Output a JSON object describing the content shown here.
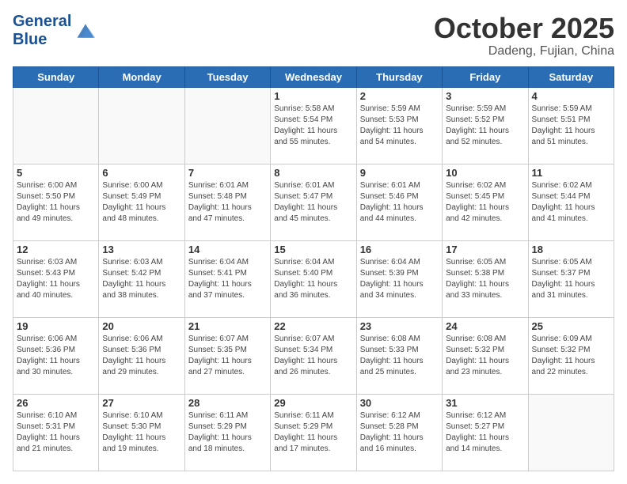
{
  "header": {
    "logo_line1": "General",
    "logo_line2": "Blue",
    "month": "October 2025",
    "location": "Dadeng, Fujian, China"
  },
  "weekdays": [
    "Sunday",
    "Monday",
    "Tuesday",
    "Wednesday",
    "Thursday",
    "Friday",
    "Saturday"
  ],
  "weeks": [
    [
      {
        "day": "",
        "info": ""
      },
      {
        "day": "",
        "info": ""
      },
      {
        "day": "",
        "info": ""
      },
      {
        "day": "1",
        "info": "Sunrise: 5:58 AM\nSunset: 5:54 PM\nDaylight: 11 hours\nand 55 minutes."
      },
      {
        "day": "2",
        "info": "Sunrise: 5:59 AM\nSunset: 5:53 PM\nDaylight: 11 hours\nand 54 minutes."
      },
      {
        "day": "3",
        "info": "Sunrise: 5:59 AM\nSunset: 5:52 PM\nDaylight: 11 hours\nand 52 minutes."
      },
      {
        "day": "4",
        "info": "Sunrise: 5:59 AM\nSunset: 5:51 PM\nDaylight: 11 hours\nand 51 minutes."
      }
    ],
    [
      {
        "day": "5",
        "info": "Sunrise: 6:00 AM\nSunset: 5:50 PM\nDaylight: 11 hours\nand 49 minutes."
      },
      {
        "day": "6",
        "info": "Sunrise: 6:00 AM\nSunset: 5:49 PM\nDaylight: 11 hours\nand 48 minutes."
      },
      {
        "day": "7",
        "info": "Sunrise: 6:01 AM\nSunset: 5:48 PM\nDaylight: 11 hours\nand 47 minutes."
      },
      {
        "day": "8",
        "info": "Sunrise: 6:01 AM\nSunset: 5:47 PM\nDaylight: 11 hours\nand 45 minutes."
      },
      {
        "day": "9",
        "info": "Sunrise: 6:01 AM\nSunset: 5:46 PM\nDaylight: 11 hours\nand 44 minutes."
      },
      {
        "day": "10",
        "info": "Sunrise: 6:02 AM\nSunset: 5:45 PM\nDaylight: 11 hours\nand 42 minutes."
      },
      {
        "day": "11",
        "info": "Sunrise: 6:02 AM\nSunset: 5:44 PM\nDaylight: 11 hours\nand 41 minutes."
      }
    ],
    [
      {
        "day": "12",
        "info": "Sunrise: 6:03 AM\nSunset: 5:43 PM\nDaylight: 11 hours\nand 40 minutes."
      },
      {
        "day": "13",
        "info": "Sunrise: 6:03 AM\nSunset: 5:42 PM\nDaylight: 11 hours\nand 38 minutes."
      },
      {
        "day": "14",
        "info": "Sunrise: 6:04 AM\nSunset: 5:41 PM\nDaylight: 11 hours\nand 37 minutes."
      },
      {
        "day": "15",
        "info": "Sunrise: 6:04 AM\nSunset: 5:40 PM\nDaylight: 11 hours\nand 36 minutes."
      },
      {
        "day": "16",
        "info": "Sunrise: 6:04 AM\nSunset: 5:39 PM\nDaylight: 11 hours\nand 34 minutes."
      },
      {
        "day": "17",
        "info": "Sunrise: 6:05 AM\nSunset: 5:38 PM\nDaylight: 11 hours\nand 33 minutes."
      },
      {
        "day": "18",
        "info": "Sunrise: 6:05 AM\nSunset: 5:37 PM\nDaylight: 11 hours\nand 31 minutes."
      }
    ],
    [
      {
        "day": "19",
        "info": "Sunrise: 6:06 AM\nSunset: 5:36 PM\nDaylight: 11 hours\nand 30 minutes."
      },
      {
        "day": "20",
        "info": "Sunrise: 6:06 AM\nSunset: 5:36 PM\nDaylight: 11 hours\nand 29 minutes."
      },
      {
        "day": "21",
        "info": "Sunrise: 6:07 AM\nSunset: 5:35 PM\nDaylight: 11 hours\nand 27 minutes."
      },
      {
        "day": "22",
        "info": "Sunrise: 6:07 AM\nSunset: 5:34 PM\nDaylight: 11 hours\nand 26 minutes."
      },
      {
        "day": "23",
        "info": "Sunrise: 6:08 AM\nSunset: 5:33 PM\nDaylight: 11 hours\nand 25 minutes."
      },
      {
        "day": "24",
        "info": "Sunrise: 6:08 AM\nSunset: 5:32 PM\nDaylight: 11 hours\nand 23 minutes."
      },
      {
        "day": "25",
        "info": "Sunrise: 6:09 AM\nSunset: 5:32 PM\nDaylight: 11 hours\nand 22 minutes."
      }
    ],
    [
      {
        "day": "26",
        "info": "Sunrise: 6:10 AM\nSunset: 5:31 PM\nDaylight: 11 hours\nand 21 minutes."
      },
      {
        "day": "27",
        "info": "Sunrise: 6:10 AM\nSunset: 5:30 PM\nDaylight: 11 hours\nand 19 minutes."
      },
      {
        "day": "28",
        "info": "Sunrise: 6:11 AM\nSunset: 5:29 PM\nDaylight: 11 hours\nand 18 minutes."
      },
      {
        "day": "29",
        "info": "Sunrise: 6:11 AM\nSunset: 5:29 PM\nDaylight: 11 hours\nand 17 minutes."
      },
      {
        "day": "30",
        "info": "Sunrise: 6:12 AM\nSunset: 5:28 PM\nDaylight: 11 hours\nand 16 minutes."
      },
      {
        "day": "31",
        "info": "Sunrise: 6:12 AM\nSunset: 5:27 PM\nDaylight: 11 hours\nand 14 minutes."
      },
      {
        "day": "",
        "info": ""
      }
    ]
  ]
}
